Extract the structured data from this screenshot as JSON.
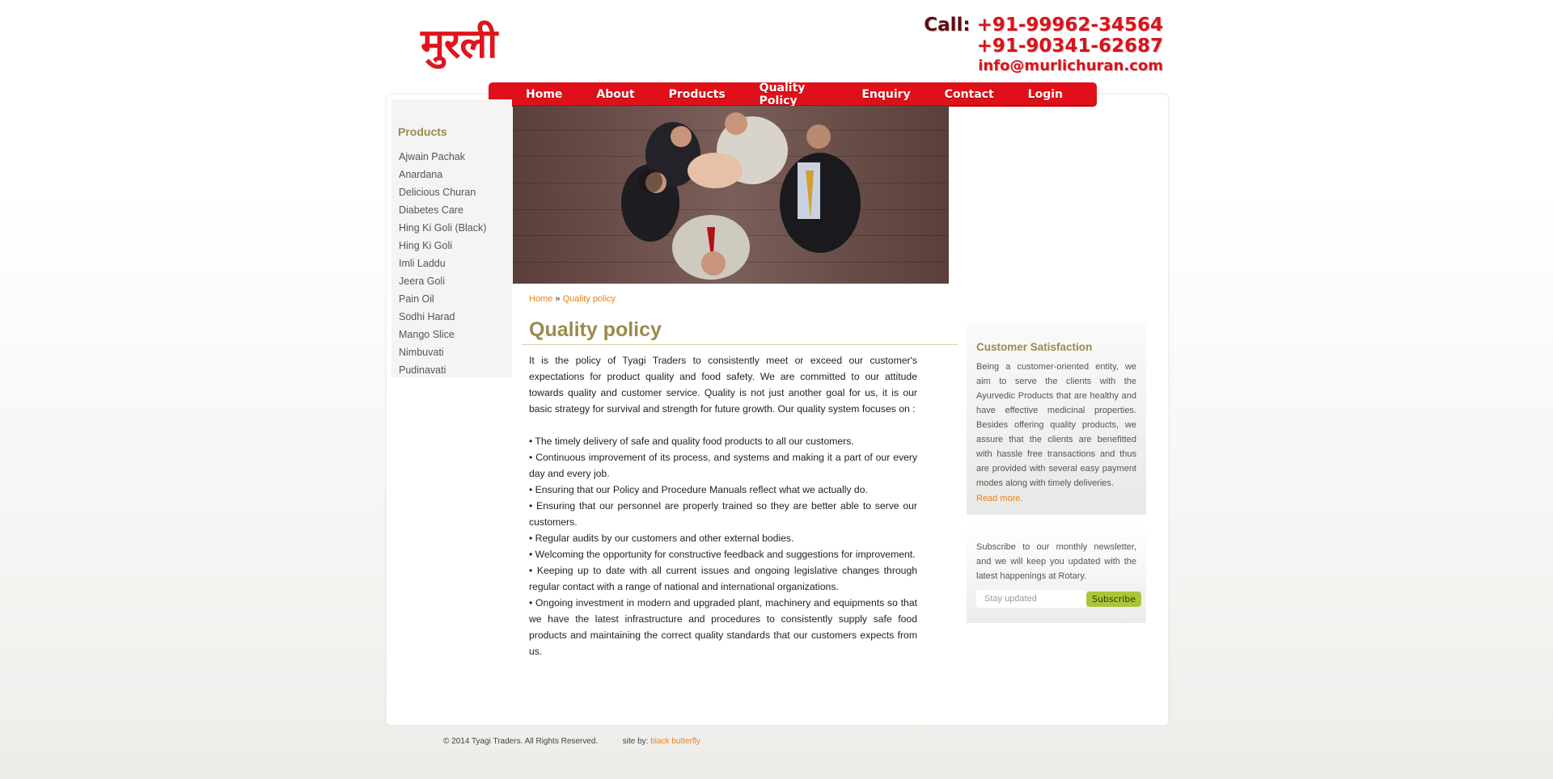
{
  "header": {
    "logo": "मुरली",
    "call_label": "Call:",
    "phone_1": "+91-99962-34564",
    "phone_2": "+91-90341-62687",
    "email": "info@murlichuran.com"
  },
  "nav": {
    "items": [
      "Home",
      "About",
      "Products",
      "Quality Policy",
      "Enquiry",
      "Contact",
      "Login"
    ]
  },
  "sidebar": {
    "title": "Products",
    "items": [
      "Ajwain Pachak",
      "Anardana",
      "Delicious Churan",
      "Diabetes Care",
      "Hing Ki Goli (Black)",
      "Hing Ki Goli",
      "Imli Laddu",
      "Jeera Goli",
      "Pain Oil",
      "Sodhi Harad",
      "Mango Slice",
      "Nimbuvati",
      "Pudinavati"
    ]
  },
  "breadcrumb": {
    "home": "Home",
    "separator": "»",
    "current": "Quality policy"
  },
  "main": {
    "title": "Quality policy",
    "intro": "It is the policy of Tyagi Traders to consistently meet or exceed our customer's expectations for product quality and food safety. We are committed to our attitude towards quality and customer service. Quality is not just another goal for us, it is our basic strategy for survival and strength for future growth. Our quality system focuses on :",
    "bullets": [
      "• The timely delivery of safe and quality food products to all our customers.",
      "• Continuous improvement of its process, and systems and making it a part of our every day and every job.",
      "• Ensuring that our Policy and Procedure Manuals reflect what we actually do.",
      "• Ensuring that our personnel are properly trained so they are better able to serve our customers.",
      "• Regular audits by our customers and other external bodies.",
      "• Welcoming the opportunity for constructive feedback and suggestions for improvement.",
      "• Keeping up to date with all current issues and ongoing legislative changes through regular contact with a range of national and international organizations.",
      "• Ongoing investment in modern and upgraded plant, machinery and equipments so that we have the latest infrastructure and procedures to consistently supply safe food products and maintaining the correct quality standards that our customers expects from us."
    ]
  },
  "aside": {
    "satisfaction_title": "Customer Satisfaction",
    "satisfaction_text": "Being a customer-oriented entity, we aim to serve the clients with the Ayurvedic Products that are healthy and have effective medicinal properties. Besides offering quality products, we assure that the clients are benefitted with hassle free transactions and thus are provided with several easy payment modes along with timely deliveries.",
    "read_more": "Read more.",
    "newsletter_text": "Subscribe to our monthly newsletter, and we will keep you updated with the latest happenings at Rotary.",
    "subscribe_placeholder": "Stay updated",
    "subscribe_label": "Subscribe"
  },
  "footer": {
    "copyright": "© 2014 Tyagi Traders. All Rights Reserved.",
    "site_by_label": "site by:",
    "site_by_link": "black butterfly"
  },
  "colors": {
    "brand_red": "#e0101a",
    "heading_gold": "#9b8a4e",
    "link_orange": "#f07f14",
    "button_green": "#a9c63a"
  }
}
